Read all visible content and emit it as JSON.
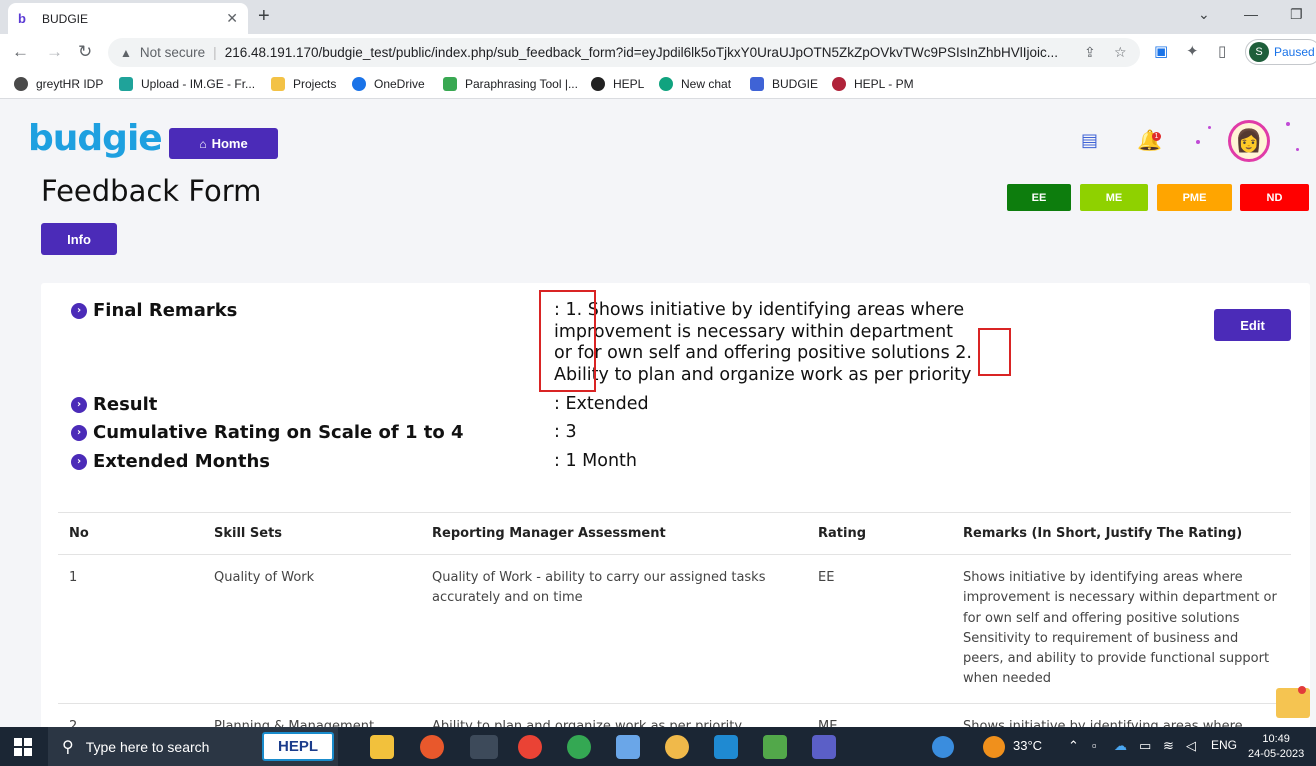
{
  "browser": {
    "tab_title": "BUDGIE",
    "security_label": "Not secure",
    "url": "216.48.191.170/budgie_test/public/index.php/sub_feedback_form?id=eyJpdil6lk5oTjkxY0UraUJpOTN5ZkZpOVkvTWc9PSIsInZhbHVlIjoic...",
    "profile_status": "Paused",
    "profile_initial": "S",
    "bookmarks": [
      {
        "label": "greytHR IDP",
        "color": "#4a4a4a"
      },
      {
        "label": "Upload - IM.GE - Fr...",
        "color": "#1fa39a"
      },
      {
        "label": "Projects",
        "color": "#f3c246"
      },
      {
        "label": "OneDrive",
        "color": "#1a73e8"
      },
      {
        "label": "Paraphrasing Tool |...",
        "color": "#39a852"
      },
      {
        "label": "HEPL",
        "color": "#222222"
      },
      {
        "label": "New chat",
        "color": "#10a37f"
      },
      {
        "label": "BUDGIE",
        "color": "#3f63d6"
      },
      {
        "label": "HEPL - PM",
        "color": "#b0233a"
      }
    ]
  },
  "header": {
    "logo_text": "budgie",
    "home_label": "Home",
    "notification_count": "1"
  },
  "form": {
    "title": "Feedback Form",
    "info_label": "Info",
    "edit_label": "Edit",
    "legend": [
      {
        "label": "EE",
        "color": "#0d7d0d"
      },
      {
        "label": "ME",
        "color": "#8fd100"
      },
      {
        "label": "PME",
        "color": "#ffa500"
      },
      {
        "label": "ND",
        "color": "#ff0000"
      }
    ],
    "fields": [
      {
        "label": "Final Remarks",
        "value_lines": [
          ": 1. Shows initiative by identifying areas where",
          "improvement is necessary within department",
          "or for own self and offering positive solutions 2.",
          "Ability to plan and organize work as per priority"
        ]
      },
      {
        "label": "Result",
        "value": ": Extended"
      },
      {
        "label": "Cumulative Rating on Scale of 1 to 4",
        "value": ": 3"
      },
      {
        "label": "Extended Months",
        "value": ": 1 Month"
      }
    ]
  },
  "table": {
    "headers": [
      "No",
      "Skill Sets",
      "Reporting Manager Assessment",
      "Rating",
      "Remarks (In Short, Justify The Rating)"
    ],
    "rows": [
      {
        "no": "1",
        "skill": "Quality of Work",
        "assessment": "Quality of Work - ability to carry our assigned tasks accurately and on time",
        "rating": "EE",
        "remarks": "Shows initiative by identifying areas where improvement is necessary within department or for own self and offering positive solutions Sensitivity to requirement of business and peers, and ability to provide functional support when needed"
      },
      {
        "no": "2",
        "skill": "Planning & Management",
        "assessment": "Ability to plan and organize work as per priority",
        "rating": "ME",
        "remarks": "Shows initiative by identifying areas where"
      }
    ]
  },
  "taskbar": {
    "search_placeholder": "Type here to search",
    "hepl_label": "HEPL",
    "weather": "33°C",
    "language": "ENG",
    "time": "10:49",
    "date": "24-05-2023"
  }
}
